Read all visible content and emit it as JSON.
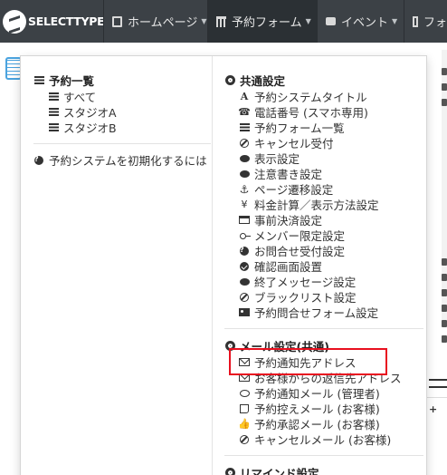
{
  "nav": {
    "brand": "SELECTTYPE",
    "items": [
      {
        "label": "ホームページ",
        "icon": "document-icon",
        "active": false
      },
      {
        "label": "予約フォーム",
        "icon": "calendar-icon",
        "active": true
      },
      {
        "label": "イベント",
        "icon": "chat-icon",
        "active": false
      },
      {
        "label": "フォ",
        "icon": "form-icon",
        "active": false
      }
    ]
  },
  "menu": {
    "left": {
      "header": "予約一覧",
      "items": [
        "すべて",
        "スタジオA",
        "スタジオB"
      ],
      "init_link": "予約システムを初期化するには"
    },
    "common": {
      "header": "共通設定",
      "items": [
        {
          "label": "予約システムタイトル",
          "icon": "font-icon"
        },
        {
          "label": "電話番号 (スマホ専用)",
          "icon": "phone-icon"
        },
        {
          "label": "予約フォーム一覧",
          "icon": "list-icon"
        },
        {
          "label": "キャンセル受付",
          "icon": "ban-icon"
        },
        {
          "label": "表示設定",
          "icon": "comment-icon"
        },
        {
          "label": "注意書き設定",
          "icon": "comment-icon"
        },
        {
          "label": "ページ遷移設定",
          "icon": "anchor-icon"
        },
        {
          "label": "料金計算／表示方法設定",
          "icon": "yen-icon"
        },
        {
          "label": "事前決済設定",
          "icon": "credit-card-icon"
        },
        {
          "label": "メンバー限定設定",
          "icon": "key-icon"
        },
        {
          "label": "お問合せ受付設定",
          "icon": "question-icon"
        },
        {
          "label": "確認画面設置",
          "icon": "check-circle-icon"
        },
        {
          "label": "終了メッセージ設定",
          "icon": "comment-icon"
        },
        {
          "label": "ブラックリスト設定",
          "icon": "ban-icon"
        },
        {
          "label": "予約問合せフォーム設定",
          "icon": "id-card-icon"
        }
      ]
    },
    "mail": {
      "header": "メール設定(共通)",
      "items": [
        {
          "label": "予約通知先アドレス",
          "icon": "envelope-icon"
        },
        {
          "label": "お客様からの返信先アドレス",
          "icon": "envelope-icon"
        },
        {
          "label": "予約通知メール (管理者)",
          "icon": "comment-outline-icon"
        },
        {
          "label": "予約控えメール (お客様)",
          "icon": "sticky-note-icon"
        },
        {
          "label": "予約承認メール (お客様)",
          "icon": "thumbs-up-icon"
        },
        {
          "label": "キャンセルメール (お客様)",
          "icon": "ban-icon"
        }
      ]
    },
    "remind": {
      "header": "リマインド設定"
    }
  },
  "colors": {
    "nav_bg": "#3c4146",
    "highlight": "#e8101f"
  }
}
